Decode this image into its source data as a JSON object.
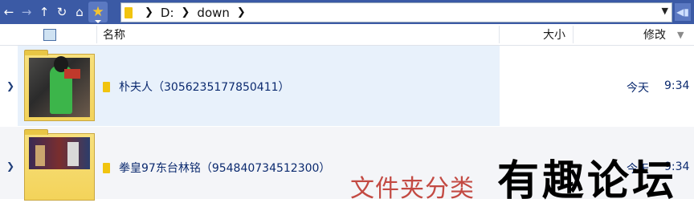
{
  "toolbar": {
    "path": [
      "D:",
      "down"
    ]
  },
  "columns": {
    "name": "名称",
    "size": "大小",
    "modified": "修改"
  },
  "rows": [
    {
      "name": "朴夫人（3056235177850411）",
      "date": "今天",
      "time": "9:34"
    },
    {
      "name": "拳皇97东台林铭（954840734512300）",
      "date": "今天",
      "time": "9:34"
    }
  ],
  "watermark": {
    "red_text": "文件夹分类",
    "black_text": "有趣论坛"
  },
  "icons": [
    "back-icon",
    "forward-icon",
    "up-icon",
    "refresh-icon",
    "home-icon",
    "favorite-star-icon",
    "folder-icon",
    "chevron-right-icon",
    "dropdown-arrow-icon",
    "thumbnail-view-icon",
    "sort-desc-icon"
  ]
}
